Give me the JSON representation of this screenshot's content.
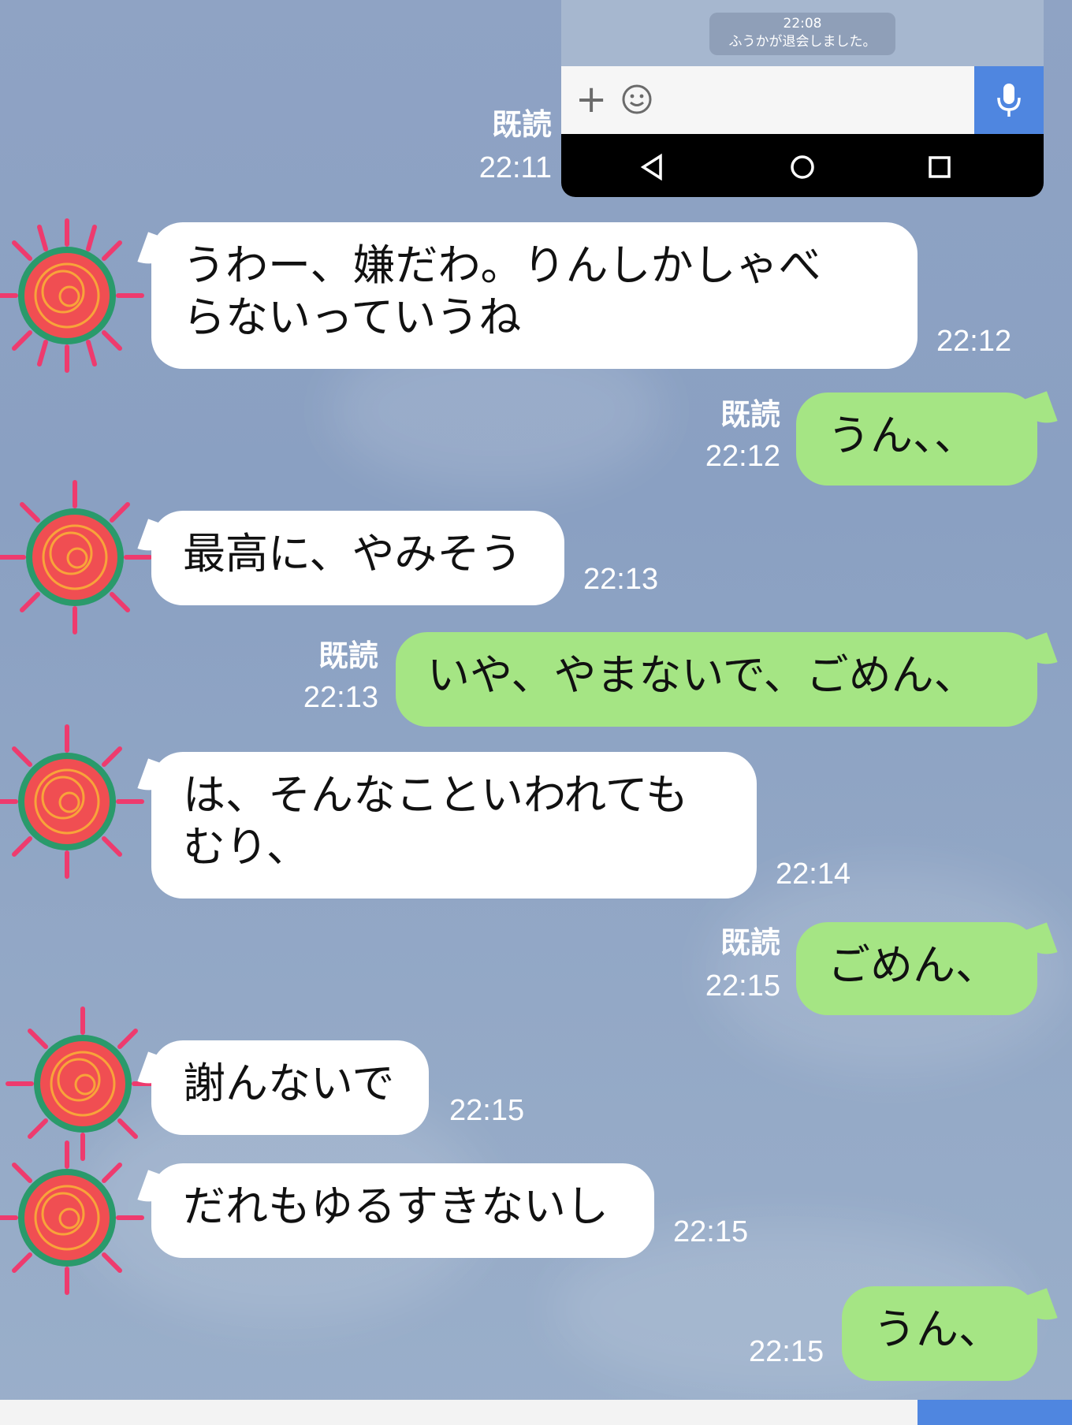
{
  "embedded": {
    "sys_time": "22:08",
    "sys_text": "ふうかが退会しました。",
    "icons": [
      "plus-icon",
      "smile-icon",
      "mic-icon",
      "back-icon",
      "home-icon",
      "recents-icon"
    ]
  },
  "messages": [
    {
      "side": "out",
      "read": "既読",
      "time": "22:11",
      "text": ""
    },
    {
      "side": "in",
      "text": "うわー、嫌だわ。りんしかしゃべらないっていうね",
      "time": "22:12"
    },
    {
      "side": "out",
      "read": "既読",
      "time": "22:12",
      "text": "うん、、"
    },
    {
      "side": "in",
      "text": "最高に、やみそう",
      "time": "22:13"
    },
    {
      "side": "out",
      "read": "既読",
      "time": "22:13",
      "text": "いや、やまないで、ごめん、"
    },
    {
      "side": "in",
      "text": "は、そんなこといわれてもむり、",
      "time": "22:14"
    },
    {
      "side": "out",
      "read": "既読",
      "time": "22:15",
      "text": "ごめん、"
    },
    {
      "side": "in",
      "text": "謝んないで",
      "time": "22:15"
    },
    {
      "side": "in",
      "text": "だれもゆるすきないし",
      "time": "22:15"
    },
    {
      "side": "out",
      "read": "",
      "time": "22:15",
      "text": "うん、"
    }
  ],
  "line_breaks": {
    "m1_l1": "うわー、嫌だわ。りんしかしゃべ",
    "m1_l2": "らないっていうね",
    "m5_l1": "は、そんなこといわれても",
    "m5_l2": "むり、"
  },
  "colors": {
    "bubble_out": "#a5e584",
    "bubble_in": "#ffffff",
    "background": "#8fa3c4",
    "accent": "#4f86e0"
  }
}
